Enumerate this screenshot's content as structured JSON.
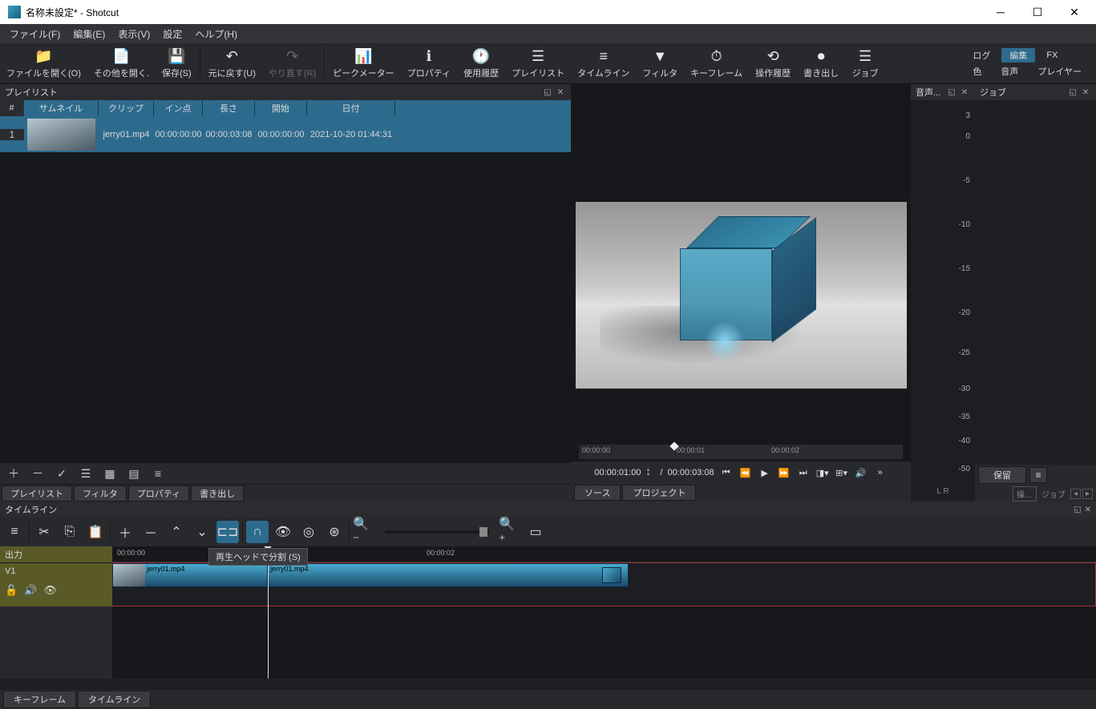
{
  "titlebar": {
    "title": "名称未設定* - Shotcut"
  },
  "menubar": {
    "file": "ファイル(F)",
    "edit": "編集(E)",
    "view": "表示(V)",
    "settings": "設定",
    "help": "ヘルプ(H)"
  },
  "toolbar": {
    "open": "ファイルを開く(O)",
    "open_other": "その他を開く.",
    "save": "保存(S)",
    "undo": "元に戻す(U)",
    "redo": "やり直す(R)",
    "peak": "ピークメーター",
    "props": "プロパティ",
    "recent": "使用履歴",
    "playlist": "プレイリスト",
    "timeline": "タイムライン",
    "filters": "フィルタ",
    "keyframes": "キーフレーム",
    "history": "操作履歴",
    "export": "書き出し",
    "jobs": "ジョブ"
  },
  "righttabs": {
    "log": "ログ",
    "edit": "編集",
    "fx": "FX",
    "color": "色",
    "audio": "音声",
    "player": "プレイヤー"
  },
  "playlist": {
    "title": "プレイリスト",
    "cols": {
      "num": "#",
      "thumb": "サムネイル",
      "clip": "クリップ",
      "in": "イン点",
      "len": "長さ",
      "start": "開始",
      "date": "日付"
    },
    "row": {
      "num": "1",
      "clip": "jerry01.mp4",
      "in": "00:00:00:00",
      "len": "00:00:03:08",
      "start": "00:00:00:00",
      "date": "2021-10-20 01:44:31"
    },
    "subtabs": {
      "playlist": "プレイリスト",
      "filters": "フィルタ",
      "props": "プロパティ",
      "export": "書き出し"
    }
  },
  "preview": {
    "scrub": {
      "t0": "00:00:00",
      "t1": "00:00:01",
      "t2": "00:00:02"
    },
    "tc_in": "00:00:01:00",
    "sep": "/",
    "tc_dur": "00:00:03:08",
    "tabs": {
      "source": "ソース",
      "project": "プロジェクト"
    }
  },
  "meter": {
    "title": "音声...",
    "labels": [
      "3",
      "0",
      "-5",
      "-10",
      "-15",
      "-20",
      "-25",
      "-30",
      "-35",
      "-40",
      "-50"
    ],
    "lr": "L  R"
  },
  "jobs": {
    "title": "ジョブ",
    "hold": "保留",
    "ops": "操…",
    "jobs_label": "ジョブ"
  },
  "timeline": {
    "title": "タイムライン",
    "tooltip": "再生ヘッドで分割 (S)",
    "master": "出力",
    "track": "V1",
    "ruler": {
      "t0": "00:00:00",
      "t1": "00:00:02"
    },
    "clip1": "jerry01.mp4",
    "clip2": "jerry01.mp4",
    "tabs": {
      "keyframes": "キーフレーム",
      "timeline": "タイムライン"
    }
  }
}
